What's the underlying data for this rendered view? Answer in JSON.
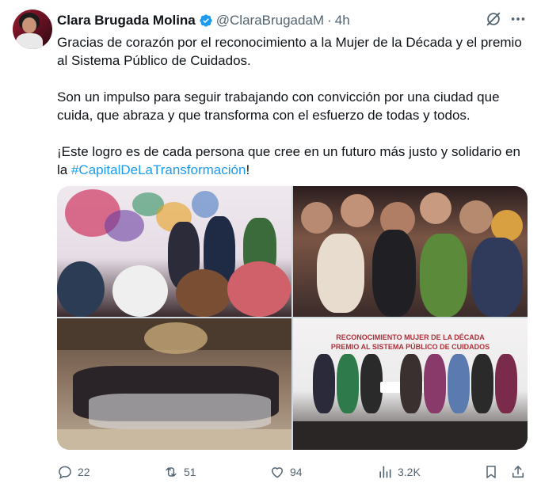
{
  "post": {
    "author_name": "Clara Brugada Molina",
    "handle": "@ClaraBrugadaM",
    "separator": "·",
    "time": "4h",
    "paragraph1": "Gracias de corazón por el reconocimiento a la Mujer de la Década y el premio al Sistema Público de Cuidados.",
    "paragraph2": "Son un impulso para seguir trabajando con convicción por una ciudad que cuida, que abraza y que transforma con el esfuerzo de todas y todos.",
    "paragraph3_prefix": "¡Este logro es de cada persona que cree en un futuro más justo y solidario en la ",
    "hashtag": "#CapitalDeLaTransformación",
    "paragraph3_suffix": "!"
  },
  "media": {
    "photo4_banner_line1": "RECONOCIMIENTO MUJER DE LA DÉCADA",
    "photo4_banner_line2": "PREMIO AL SISTEMA PÚBLICO DE CUIDADOS"
  },
  "actions": {
    "replies": "22",
    "reposts": "51",
    "likes": "94",
    "views": "3.2K"
  },
  "colors": {
    "accent": "#1d9bf0",
    "muted": "#536471",
    "text": "#0f1419"
  },
  "icons": [
    "verified-badge-icon",
    "grok-icon",
    "more-icon",
    "reply-icon",
    "repost-icon",
    "like-icon",
    "views-icon",
    "bookmark-icon",
    "share-icon"
  ]
}
